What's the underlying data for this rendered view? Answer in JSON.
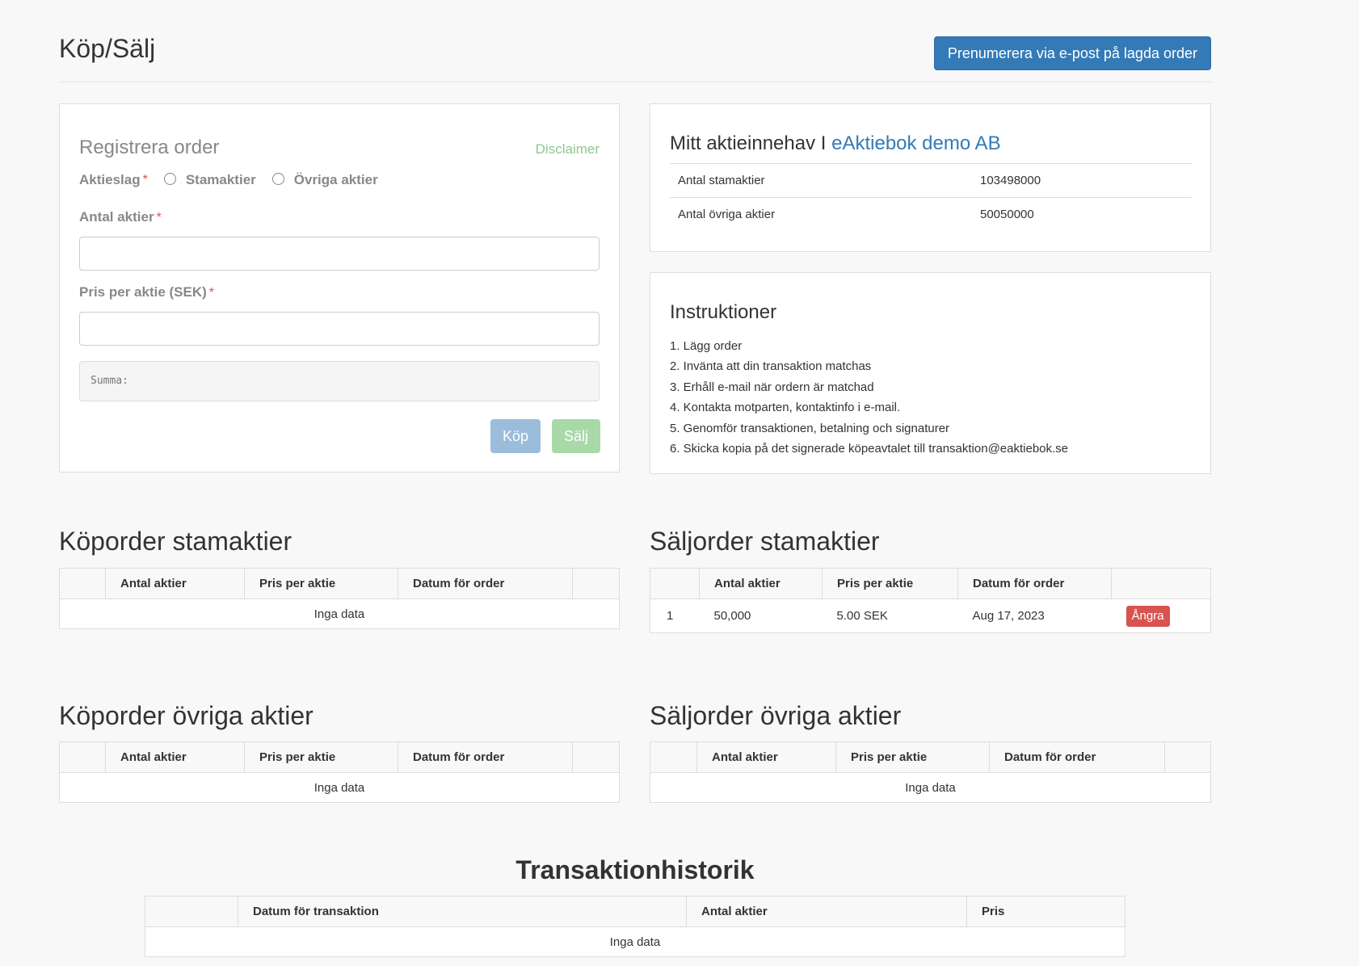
{
  "header": {
    "title": "Köp/Sälj",
    "subscribe_label": "Prenumerera via e-post på lagda order"
  },
  "register": {
    "title": "Registrera order",
    "disclaimer": "Disclaimer",
    "aktieslag_label": "Aktieslag",
    "required_mark": "*",
    "option_stam": "Stamaktier",
    "option_ovriga": "Övriga aktier",
    "antal_label": "Antal aktier",
    "pris_label": "Pris per aktie (SEK)",
    "summa_label": "Summa:",
    "buy_label": "Köp",
    "sell_label": "Sälj"
  },
  "holdings": {
    "title_prefix": "Mitt aktieinnehav I ",
    "company": "eAktiebok demo AB",
    "rows": [
      {
        "label": "Antal stamaktier",
        "value": "103498000"
      },
      {
        "label": "Antal övriga aktier",
        "value": "50050000"
      }
    ]
  },
  "instructions": {
    "title": "Instruktioner",
    "items": [
      "1. Lägg order",
      "2. Invänta att din transaktion matchas",
      "3. Erhåll e-mail när ordern är matchad",
      "4. Kontakta motparten, kontaktinfo i e-mail.",
      "5. Genomför transaktionen, betalning och signaturer",
      "6. Skicka kopia på det signerade köpeavtalet till transaktion@eaktiebok.se"
    ]
  },
  "columns": {
    "antal": "Antal aktier",
    "pris": "Pris per aktie",
    "datum": "Datum för order"
  },
  "no_data": "Inga data",
  "buy_stam": {
    "title": "Köporder stamaktier"
  },
  "sell_stam": {
    "title": "Säljorder stamaktier",
    "row": {
      "index": "1",
      "antal": "50,000",
      "pris": "5.00 SEK",
      "datum": "Aug 17, 2023",
      "action": "Ångra"
    }
  },
  "buy_ovriga": {
    "title": "Köporder övriga aktier"
  },
  "sell_ovriga": {
    "title": "Säljorder övriga aktier"
  },
  "history": {
    "title": "Transaktionhistorik",
    "col_datum": "Datum för transaktion",
    "col_antal": "Antal aktier",
    "col_pris": "Pris"
  }
}
